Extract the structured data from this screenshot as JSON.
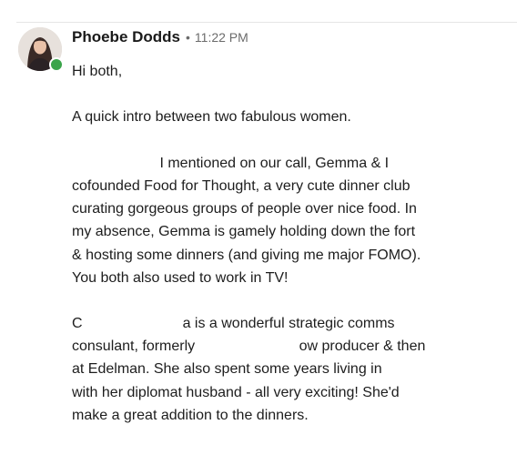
{
  "message": {
    "sender_name": "Phoebe Dodds",
    "separator": "•",
    "timestamp": "11:22 PM",
    "presence_color": "#3aa44a",
    "paragraphs": {
      "greeting": "Hi both,",
      "intro": "A quick intro between two fabulous women.",
      "p2": {
        "l1_partial": "I mentioned on our call, Gemma & I",
        "l2": "cofounded Food for Thought, a very cute dinner club",
        "l3": "curating gorgeous groups of people over nice food. In",
        "l4": "my absence, Gemma is gamely holding down the fort",
        "l5": "& hosting some dinners (and giving me major FOMO).",
        "l6": "You both also used to work in TV!"
      },
      "p3": {
        "l1_start": "C",
        "l1_end": "a is a wonderful strategic comms",
        "l2_start": "consulant, formerly",
        "l2_end": "ow producer & then",
        "l3": "at Edelman. She also spent some years living in",
        "l4": "with her diplomat husband - all very exciting! She'd",
        "l5": "make a great addition to the dinners."
      }
    }
  }
}
